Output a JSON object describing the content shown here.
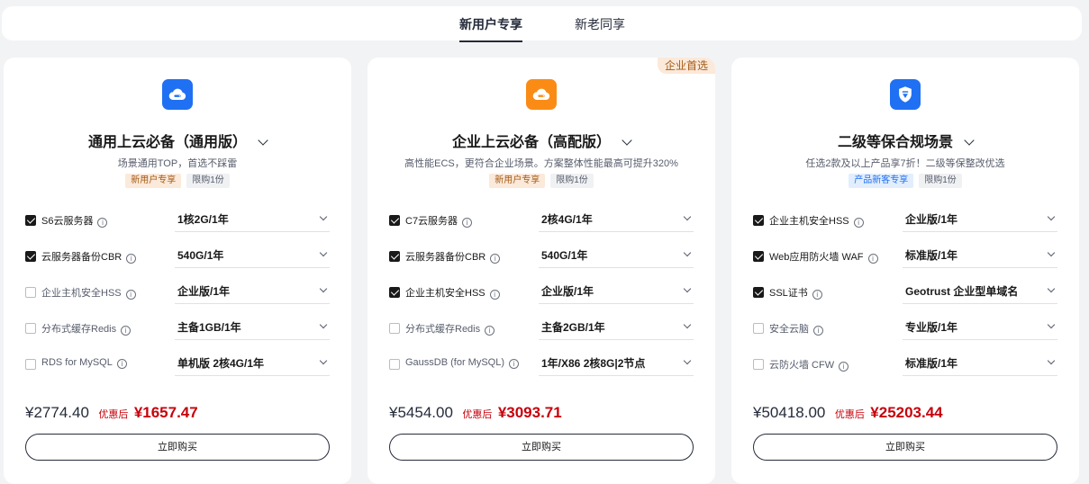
{
  "tabs": [
    {
      "label": "新用户专享",
      "active": true
    },
    {
      "label": "新老同享",
      "active": false
    }
  ],
  "cards": [
    {
      "icon": "cloud-server-icon",
      "icon_color": "#2070f3",
      "corner_badge": "",
      "title": "通用上云必备（通用版）",
      "subtitle": "场景通用TOP，首选不踩雷",
      "tags": [
        {
          "text": "新用户专享",
          "style": "orange"
        },
        {
          "text": "限购1份",
          "style": "gray"
        }
      ],
      "items": [
        {
          "label": "S6云服务器",
          "checked": true,
          "value": "1核2G/1年"
        },
        {
          "label": "云服务器备份CBR",
          "checked": true,
          "value": "540G/1年"
        },
        {
          "label": "企业主机安全HSS",
          "checked": false,
          "value": "企业版/1年"
        },
        {
          "label": "分布式缓存Redis",
          "checked": false,
          "value": "主备1GB/1年"
        },
        {
          "label": "RDS for MySQL",
          "checked": false,
          "value": "单机版 2核4G/1年"
        }
      ],
      "original_price": "¥2774.40",
      "discount_label": "优惠后",
      "discount_price": "¥1657.47",
      "buy_label": "立即购买"
    },
    {
      "icon": "cloud-server-icon",
      "icon_color": "#fa8c16",
      "corner_badge": "企业首选",
      "title": "企业上云必备（高配版）",
      "subtitle": "高性能ECS，更符合企业场景。方案整体性能最高可提升320%",
      "tags": [
        {
          "text": "新用户专享",
          "style": "orange"
        },
        {
          "text": "限购1份",
          "style": "gray"
        }
      ],
      "items": [
        {
          "label": "C7云服务器",
          "checked": true,
          "value": "2核4G/1年"
        },
        {
          "label": "云服务器备份CBR",
          "checked": true,
          "value": "540G/1年"
        },
        {
          "label": "企业主机安全HSS",
          "checked": true,
          "value": "企业版/1年"
        },
        {
          "label": "分布式缓存Redis",
          "checked": false,
          "value": "主备2GB/1年"
        },
        {
          "label": "GaussDB (for MySQL)",
          "checked": false,
          "value": "1年/X86 2核8G|2节点"
        }
      ],
      "original_price": "¥5454.00",
      "discount_label": "优惠后",
      "discount_price": "¥3093.71",
      "buy_label": "立即购买"
    },
    {
      "icon": "shield-icon",
      "icon_color": "#2070f3",
      "corner_badge": "",
      "title": "二级等保合规场景",
      "subtitle": "任选2款及以上产品享7折！二级等保整改优选",
      "tags": [
        {
          "text": "产品新客专享",
          "style": "blue"
        },
        {
          "text": "限购1份",
          "style": "gray"
        }
      ],
      "items": [
        {
          "label": "企业主机安全HSS",
          "checked": true,
          "value": "企业版/1年"
        },
        {
          "label": "Web应用防火墙 WAF",
          "checked": true,
          "value": "标准版/1年"
        },
        {
          "label": "SSL证书",
          "checked": true,
          "value": "Geotrust 企业型单域名"
        },
        {
          "label": "安全云脑",
          "checked": false,
          "value": "专业版/1年"
        },
        {
          "label": "云防火墙 CFW",
          "checked": false,
          "value": "标准版/1年"
        }
      ],
      "original_price": "¥50418.00",
      "discount_label": "优惠后",
      "discount_price": "¥25203.44",
      "buy_label": "立即购买"
    }
  ]
}
